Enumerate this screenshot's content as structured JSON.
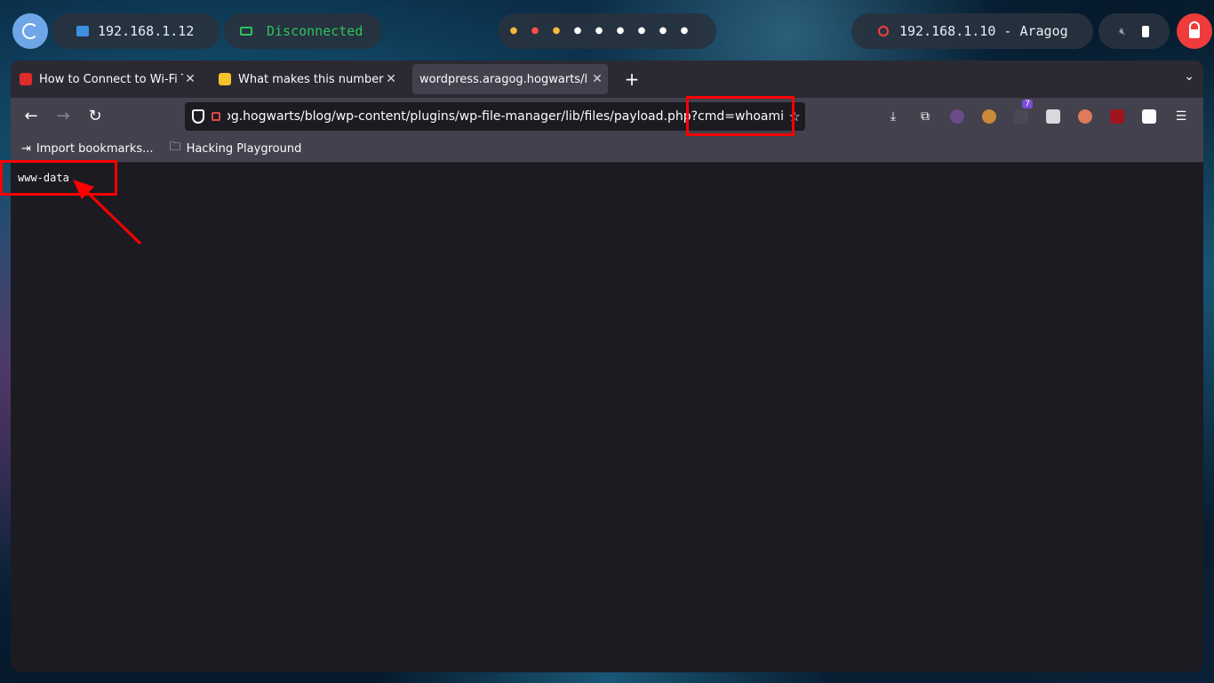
{
  "topbar": {
    "host_ip": "192.168.1.12",
    "vpn_status": "Disconnected",
    "workspaces": [
      {
        "color": "#f6b93b"
      },
      {
        "color": "#ff4d4d"
      },
      {
        "color": "#f6b93b"
      },
      {
        "color": "#ffffff"
      },
      {
        "color": "#ffffff"
      },
      {
        "color": "#ffffff"
      },
      {
        "color": "#ffffff"
      },
      {
        "color": "#ffffff"
      },
      {
        "color": "#ffffff"
      }
    ],
    "target": "192.168.1.10 - Aragog"
  },
  "browser": {
    "tabs": [
      {
        "title": "How to Connect to Wi-Fi Th",
        "favicon": "hud-icon"
      },
      {
        "title": "What makes this number s",
        "favicon": "rocket-icon"
      },
      {
        "title": "wordpress.aragog.hogwarts/l",
        "favicon": "none"
      }
    ],
    "url": "wordpress.aragog.hogwarts/blog/wp-content/plugins/wp-file-manager/lib/files/payload.php?cmd=whoami",
    "extension_badge": "7",
    "bookmarks": [
      {
        "label": "Import bookmarks...",
        "icon": "import-icon"
      },
      {
        "label": "Hacking Playground",
        "icon": "folder-icon"
      }
    ],
    "page_output": "www-data"
  },
  "colors": {
    "annotation": "#ff0000",
    "browser_bg": "#1c1b22",
    "toolbar_bg": "#42414d"
  }
}
